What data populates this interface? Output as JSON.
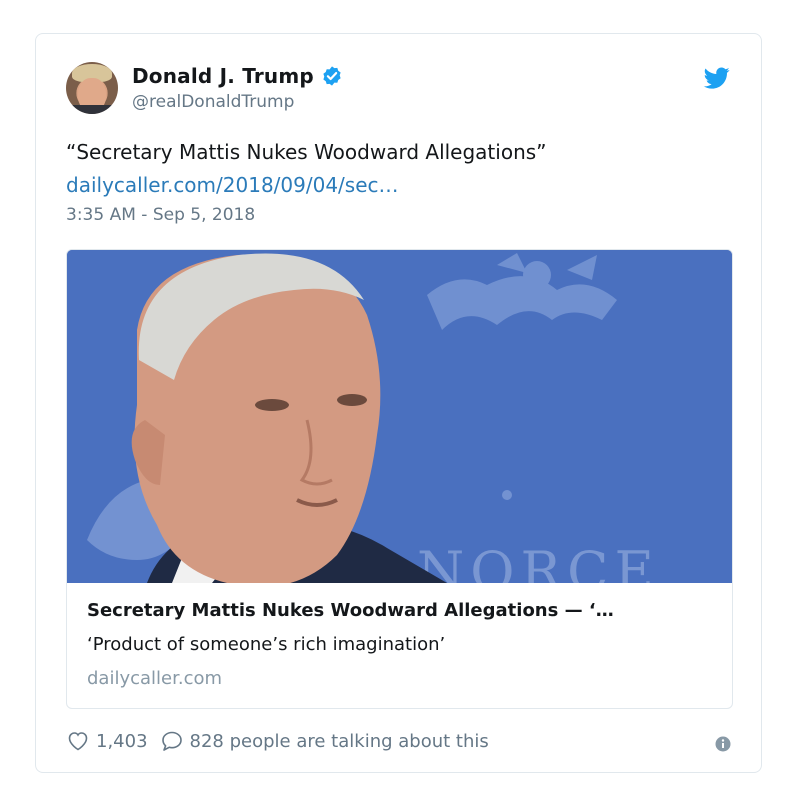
{
  "author": {
    "display_name": "Donald J. Trump",
    "handle": "@realDonaldTrump",
    "verified": true
  },
  "tweet": {
    "text": "“Secretary Mattis Nukes Woodward Allegations”",
    "link": "dailycaller.com/2018/09/04/sec…",
    "timestamp": "3:35 AM - Sep 5, 2018"
  },
  "card": {
    "title": "Secretary Mattis Nukes Woodward Allegations — ‘…",
    "description": "‘Product of someone’s rich imagination’",
    "domain": "dailycaller.com",
    "image_backdrop_text": "NORCE"
  },
  "actions": {
    "likes": "1,403",
    "conversation": "828 people are talking about this"
  },
  "colors": {
    "link": "#2b7bb9",
    "verified": "#1da1f2",
    "secondary_text": "#657786",
    "image_background": "#4a70bf"
  },
  "icons": [
    "verified-badge-icon",
    "twitter-bird-icon",
    "heart-icon",
    "comment-bubble-icon",
    "info-icon"
  ]
}
